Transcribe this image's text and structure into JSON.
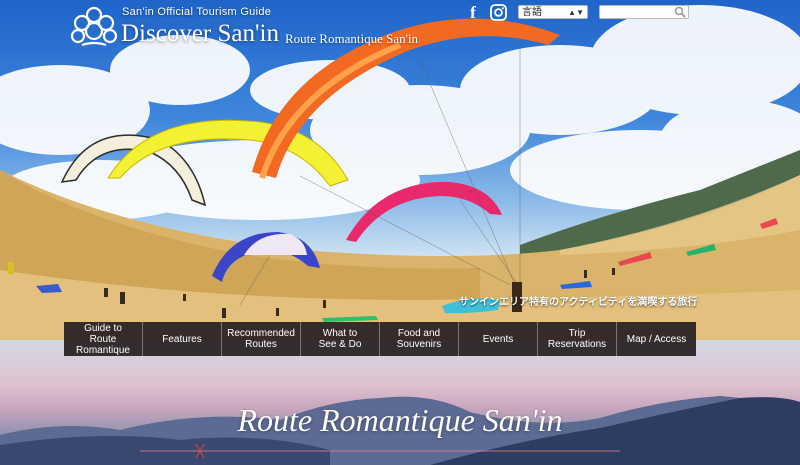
{
  "header": {
    "tagline": "San'in Official Tourism Guide",
    "site_title": "Discover San'in",
    "site_subtitle": "Route Romantique San'in",
    "social": [
      {
        "name": "facebook-icon"
      },
      {
        "name": "instagram-icon"
      }
    ],
    "language_select": {
      "selected": "言語"
    },
    "search": {
      "placeholder": "",
      "value": ""
    }
  },
  "hero": {
    "caption": "サンインエリア特有のアクティビティを満喫する旅行"
  },
  "nav": {
    "items": [
      {
        "label": "Guide to\nRoute Romantique"
      },
      {
        "label": "Features"
      },
      {
        "label": "Recommended\nRoutes"
      },
      {
        "label": "What to\nSee & Do"
      },
      {
        "label": "Food and\nSouvenirs"
      },
      {
        "label": "Events"
      },
      {
        "label": "Trip\nReservations"
      },
      {
        "label": "Map / Access"
      }
    ]
  },
  "banner": {
    "title": "Route Romantique San'in"
  },
  "colors": {
    "nav_bg": "#282022",
    "text": "#ffffff"
  }
}
